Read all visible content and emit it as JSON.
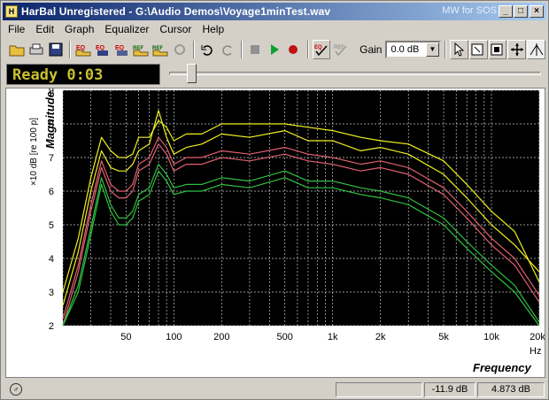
{
  "window": {
    "title": "HarBal Unregistered - G:\\Audio Demos\\Voyage1minTest.wav",
    "tag": "MW for SOS",
    "controls": {
      "minimize": "_",
      "maximize": "□",
      "close": "×"
    }
  },
  "menu": [
    "File",
    "Edit",
    "Graph",
    "Equalizer",
    "Cursor",
    "Help"
  ],
  "toolbar": {
    "gain_label": "Gain",
    "gain_value": "0.0 dB"
  },
  "status": {
    "ready_text": "Ready 0:03"
  },
  "graph": {
    "ylabel": "Magnitude",
    "yunit": "×10 dB [re 100 p]",
    "xlabel": "Frequency",
    "xunit": "Hz"
  },
  "statusbar": {
    "value1": "-11.9 dB",
    "value2": "4.873 dB"
  },
  "colors": {
    "yellow": "#f0f020",
    "red": "#e06070",
    "green": "#30c040",
    "grid": "#c8c8c8"
  },
  "chart_data": {
    "type": "line",
    "xscale": "log",
    "xlim": [
      20,
      20000
    ],
    "ylim": [
      2,
      9
    ],
    "yticks": [
      2,
      3,
      4,
      5,
      6,
      7,
      8,
      9
    ],
    "xticks": [
      {
        "v": 50,
        "label": "50"
      },
      {
        "v": 100,
        "label": "100"
      },
      {
        "v": 200,
        "label": "200"
      },
      {
        "v": 500,
        "label": "500"
      },
      {
        "v": 1000,
        "label": "1k"
      },
      {
        "v": 2000,
        "label": "2k"
      },
      {
        "v": 5000,
        "label": "5k"
      },
      {
        "v": 10000,
        "label": "10k"
      },
      {
        "v": 20000,
        "label": "20k"
      }
    ],
    "x": [
      20,
      25,
      30,
      35,
      40,
      45,
      50,
      55,
      60,
      70,
      80,
      90,
      100,
      120,
      150,
      200,
      300,
      500,
      700,
      1000,
      1500,
      2000,
      3000,
      5000,
      7000,
      10000,
      14000,
      20000
    ],
    "series": [
      {
        "color": "yellow",
        "values": [
          3.0,
          4.6,
          6.4,
          7.6,
          7.2,
          7.0,
          7.0,
          7.1,
          7.6,
          7.6,
          8.1,
          7.9,
          7.5,
          7.7,
          7.7,
          8.0,
          8.0,
          8.0,
          7.9,
          7.8,
          7.6,
          7.5,
          7.4,
          6.9,
          6.2,
          5.4,
          4.8,
          3.3
        ]
      },
      {
        "color": "yellow",
        "values": [
          2.6,
          4.2,
          6.0,
          7.2,
          6.7,
          6.6,
          6.6,
          6.8,
          7.2,
          7.4,
          8.4,
          7.6,
          7.1,
          7.3,
          7.4,
          7.7,
          7.6,
          7.8,
          7.5,
          7.5,
          7.2,
          7.3,
          7.1,
          6.5,
          5.8,
          5.0,
          4.4,
          3.6
        ]
      },
      {
        "color": "red",
        "values": [
          2.2,
          3.8,
          5.6,
          6.9,
          6.2,
          6.0,
          6.0,
          6.2,
          6.8,
          7.0,
          7.6,
          7.3,
          6.8,
          7.0,
          7.0,
          7.2,
          7.1,
          7.3,
          7.1,
          7.0,
          6.8,
          6.9,
          6.7,
          6.1,
          5.4,
          4.6,
          4.0,
          2.9
        ]
      },
      {
        "color": "red",
        "values": [
          2.0,
          3.6,
          5.4,
          6.7,
          6.0,
          5.8,
          5.8,
          6.0,
          6.6,
          6.8,
          7.4,
          7.1,
          6.6,
          6.8,
          6.8,
          7.0,
          6.9,
          7.1,
          6.9,
          6.8,
          6.6,
          6.7,
          6.5,
          5.9,
          5.2,
          4.4,
          3.8,
          2.7
        ]
      },
      {
        "color": "green",
        "values": [
          1.6,
          3.2,
          4.9,
          6.4,
          5.6,
          5.2,
          5.2,
          5.4,
          5.9,
          6.1,
          6.8,
          6.5,
          6.1,
          6.2,
          6.2,
          6.4,
          6.3,
          6.6,
          6.3,
          6.3,
          6.1,
          6.0,
          5.8,
          5.2,
          4.5,
          3.8,
          3.2,
          2.1
        ]
      },
      {
        "color": "green",
        "values": [
          1.4,
          3.0,
          4.7,
          6.2,
          5.4,
          5.0,
          5.0,
          5.2,
          5.7,
          5.9,
          6.6,
          6.3,
          5.9,
          6.0,
          6.0,
          6.2,
          6.1,
          6.4,
          6.1,
          6.1,
          5.9,
          5.8,
          5.6,
          5.0,
          4.3,
          3.6,
          3.0,
          1.9
        ]
      }
    ]
  }
}
